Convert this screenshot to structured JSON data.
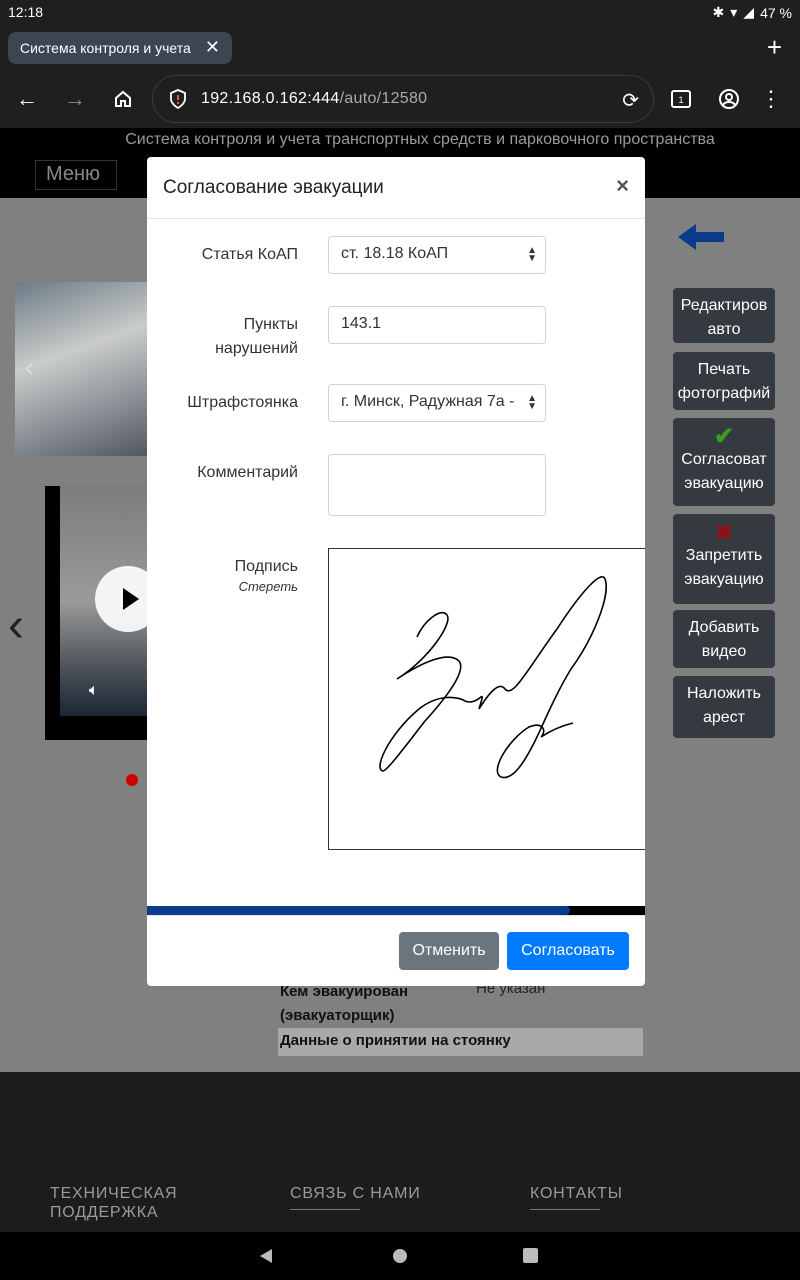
{
  "status_bar": {
    "time": "12:18",
    "battery": "47 %"
  },
  "browser": {
    "tab_title": "Система контроля и учета",
    "url_host": "192.168.0.162:444",
    "url_path": "/auto/12580"
  },
  "page": {
    "header_title": "Система контроля и учета транспортных средств и парковочного пространства",
    "menu_label": "Меню",
    "side_buttons": [
      {
        "label": "Редактиров\nавто"
      },
      {
        "label": "Печать\nфотографий"
      },
      {
        "label": "Согласоват\nэвакуацию"
      },
      {
        "label": "Запретить\nэвакуацию"
      },
      {
        "label": "Добавить\nвидео"
      },
      {
        "label": "Наложить\nарест"
      }
    ],
    "info": {
      "evacuated_by_label": "Кем эвакуирован (эвакуаторщик)",
      "evacuated_by_value": "Не указан",
      "parking_section": "Данные о принятии на стоянку"
    },
    "footer": {
      "support": "ТЕХНИЧЕСКАЯ ПОДДЕРЖКА",
      "contact": "СВЯЗЬ С НАМИ",
      "contacts": "КОНТАКТЫ"
    }
  },
  "modal": {
    "title": "Согласование эвакуации",
    "close": "×",
    "article_label": "Статья КоАП",
    "article_value": "ст. 18.18 КоАП",
    "points_label": "Пункты нарушений",
    "points_value": "143.1",
    "impound_label": "Штрафстоянка",
    "impound_value": "г. Минск, Радужная 7а -",
    "comment_label": "Комментарий",
    "comment_value": "",
    "signature_label": "Подпись",
    "signature_clear": "Стереть",
    "progress": 0.85,
    "cancel_label": "Отменить",
    "confirm_label": "Согласовать"
  },
  "colors": {
    "primary": "#007bff",
    "secondary": "#6c757d",
    "dark_button": "#343a40",
    "progress": "#0b3b8c"
  }
}
